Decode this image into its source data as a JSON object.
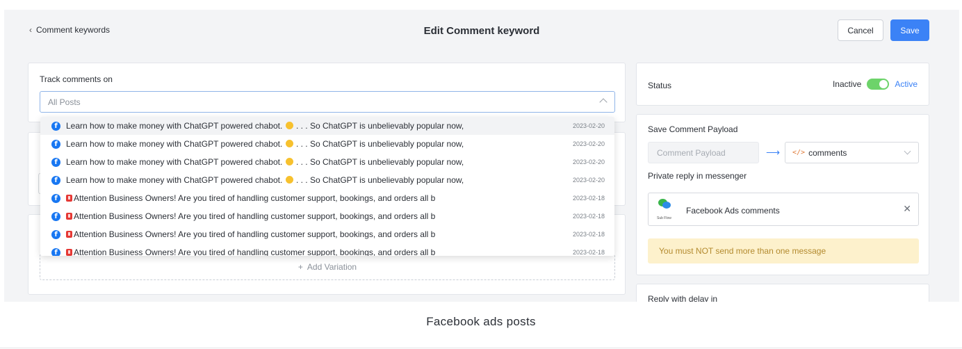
{
  "header": {
    "back_label": "Comment keywords",
    "title": "Edit Comment keyword",
    "cancel_label": "Cancel",
    "save_label": "Save"
  },
  "track": {
    "label": "Track comments on",
    "selected": "All Posts"
  },
  "posts": [
    {
      "text_a": "Learn how to make money with ChatGPT powered chabot. ",
      "emoji": "smile",
      "text_b": " . . . So ChatGPT is unbelievably popular now,",
      "date": "2023-02-20"
    },
    {
      "text_a": "Learn how to make money with ChatGPT powered chabot. ",
      "emoji": "smile",
      "text_b": " . . . So ChatGPT is unbelievably popular now,",
      "date": "2023-02-20"
    },
    {
      "text_a": "Learn how to make money with ChatGPT powered chabot. ",
      "emoji": "smile",
      "text_b": " . . . So ChatGPT is unbelievably popular now,",
      "date": "2023-02-20"
    },
    {
      "text_a": "Learn how to make money with ChatGPT powered chabot. ",
      "emoji": "smile",
      "text_b": " . . . So ChatGPT is unbelievably popular now,",
      "date": "2023-02-20"
    },
    {
      "text_a": "Attention Business Owners! Are you tired of handling customer support, bookings, and orders all b",
      "emoji": "alert",
      "text_b": "",
      "date": "2023-02-18"
    },
    {
      "text_a": "Attention Business Owners! Are you tired of handling customer support, bookings, and orders all b",
      "emoji": "alert",
      "text_b": "",
      "date": "2023-02-18"
    },
    {
      "text_a": "Attention Business Owners! Are you tired of handling customer support, bookings, and orders all b",
      "emoji": "alert",
      "text_b": "",
      "date": "2023-02-18"
    },
    {
      "text_a": "Attention Business Owners! Are you tired of handling customer support, bookings, and orders all b",
      "emoji": "alert",
      "text_b": "",
      "date": "2023-02-18"
    }
  ],
  "add_variation_label": "Add Variation",
  "status": {
    "label": "Status",
    "inactive_label": "Inactive",
    "active_label": "Active",
    "is_active": true
  },
  "payload": {
    "label": "Save Comment Payload",
    "placeholder": "Comment Payload",
    "variable": "comments"
  },
  "private_reply": {
    "label": "Private reply in messenger",
    "subflow_tag": "Sub Flow",
    "subflow_name": "Facebook Ads comments",
    "warning": "You must NOT send more than one message"
  },
  "delay": {
    "label": "Reply with delay in"
  },
  "caption": "Facebook ads posts",
  "colors": {
    "accent": "#3b82f6",
    "toggle_on": "#6dd36a",
    "warning_bg": "#fdf1cc",
    "facebook": "#1877f2"
  }
}
